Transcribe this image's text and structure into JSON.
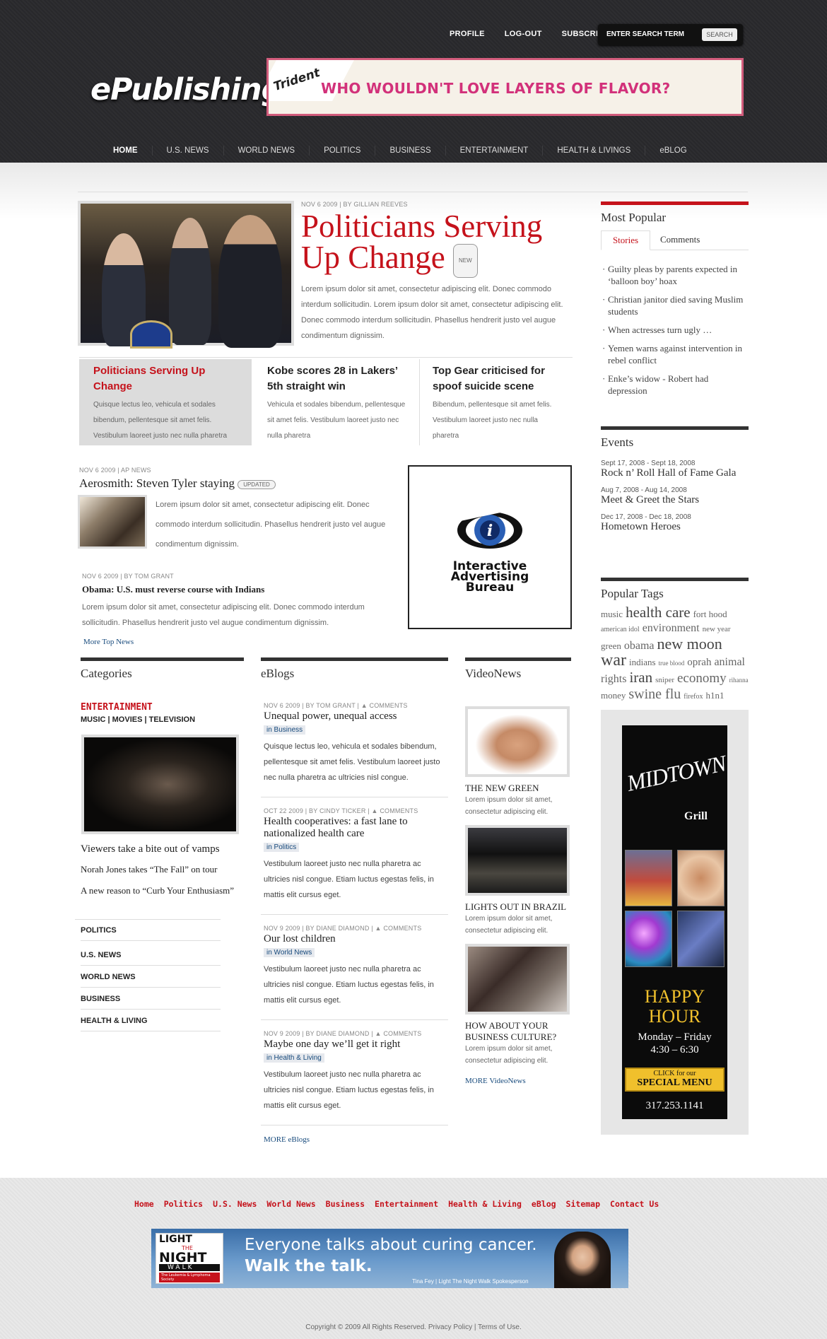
{
  "header": {
    "logo": "ePublishing",
    "top_links": [
      "PROFILE",
      "LOG-OUT",
      "SUBSCRIBE"
    ],
    "search": {
      "placeholder": "ENTER SEARCH TERM",
      "button": "SEARCH"
    },
    "banner": {
      "brand": "Trident",
      "text": "WHO WOULDN'T LOVE LAYERS OF FLAVOR?"
    },
    "nav": [
      "HOME",
      "U.S. NEWS",
      "WORLD NEWS",
      "POLITICS",
      "BUSINESS",
      "ENTERTAINMENT",
      "HEALTH & LIVINGS",
      "eBLOG"
    ]
  },
  "featured": {
    "meta": "NOV 6 2009 | BY GILLIAN REEVES",
    "title": "Politicians Serving Up Change",
    "badge": "NEW",
    "body": "Lorem ipsum dolor sit amet, consectetur adipiscing elit. Donec commodo interdum sollicitudin. Lorem ipsum dolor sit amet, consectetur adipiscing elit. Donec commodo interdum sollicitudin. Phasellus hendrerit justo vel augue condimentum dignissim."
  },
  "subfeatures": [
    {
      "title": "Politicians Serving Up Change",
      "body": "Quisque lectus leo, vehicula et sodales bibendum, pellentesque sit amet felis. Vestibulum laoreet justo nec nulla pharetra"
    },
    {
      "title": "Kobe scores 28 in Lakers’ 5th straight win",
      "body": "Vehicula et sodales bibendum, pellentesque sit amet felis. Vestibulum laoreet justo nec nulla pharetra"
    },
    {
      "title": "Top Gear criticised for spoof suicide scene",
      "body": "Bibendum, pellentesque sit amet felis. Vestibulum laoreet justo nec nulla pharetra"
    }
  ],
  "secondary": {
    "meta1": "NOV 6 2009 | AP NEWS",
    "title1": "Aerosmith: Steven Tyler staying",
    "badge1": "UPDATED",
    "body1": "Lorem ipsum dolor sit amet, consectetur adipiscing elit. Donec commodo interdum sollicitudin. Phasellus hendrerit justo vel augue condimentum dignissim.",
    "meta2": "NOV 6 2009 | BY TOM GRANT",
    "title2": "Obama: U.S. must reverse course with Indians",
    "body2": "Lorem ipsum dolor sit amet, consectetur adipiscing elit. Donec commodo interdum sollicitudin. Phasellus hendrerit justo vel augue condimentum dignissim.",
    "more": "More Top News"
  },
  "iab_ad": {
    "line1": "Interactive",
    "line2": "Advertising",
    "line3": "Bureau"
  },
  "categories": {
    "heading": "Categories",
    "label": "ENTERTAINMENT",
    "sub": "MUSIC | MOVIES | TELEVISION",
    "stories": [
      "Viewers take a bite out of vamps",
      "Norah Jones takes “The Fall” on tour",
      "A new reason to “Curb Your Enthusiasm”"
    ],
    "links": [
      "POLITICS",
      "U.S. NEWS",
      "WORLD NEWS",
      "BUSINESS",
      "HEALTH & LIVING"
    ]
  },
  "eblogs": {
    "heading": "eBlogs",
    "items": [
      {
        "date": "NOV 6 2009",
        "author": "BY TOM GRANT",
        "comments": "COMMENTS",
        "title": "Unequal power, unequal access",
        "cat": "in Business",
        "body": "Quisque lectus leo, vehicula et sodales bibendum, pellentesque sit amet felis. Vestibulum laoreet justo nec nulla pharetra ac ultricies nisl congue."
      },
      {
        "date": "OCT 22 2009",
        "author": "BY CINDY TICKER",
        "comments": "COMMENTS",
        "title": "Health cooperatives: a fast lane to nationalized health care",
        "cat": "in Politics",
        "body": "Vestibulum laoreet justo nec nulla pharetra ac ultricies nisl congue. Etiam luctus egestas felis, in mattis elit cursus eget."
      },
      {
        "date": "NOV 9 2009",
        "author": "BY DIANE DIAMOND",
        "comments": "COMMENTS",
        "title": "Our lost children",
        "cat": "in World News",
        "body": "Vestibulum laoreet justo nec nulla pharetra ac ultricies nisl congue. Etiam luctus egestas felis, in mattis elit cursus eget."
      },
      {
        "date": "NOV 9 2009",
        "author": "BY DIANE DIAMOND",
        "comments": "COMMENTS",
        "title": "Maybe one day we’ll get it right",
        "cat": "in Health & Living",
        "body": "Vestibulum laoreet justo nec nulla pharetra ac ultricies nisl congue. Etiam luctus egestas felis, in mattis elit cursus eget."
      }
    ],
    "more": "MORE eBlogs"
  },
  "videonews": {
    "heading": "VideoNews",
    "items": [
      {
        "title": "THE NEW GREEN",
        "body": "Lorem ipsum dolor sit amet, consectetur adipiscing elit."
      },
      {
        "title": "LIGHTS OUT IN BRAZIL",
        "body": "Lorem ipsum dolor sit amet, consectetur adipiscing elit."
      },
      {
        "title": "HOW ABOUT YOUR BUSINESS CULTURE?",
        "body": "Lorem ipsum dolor sit amet, consectetur adipiscing elit."
      }
    ],
    "more": "MORE VideoNews"
  },
  "sidebar": {
    "popular_heading": "Most Popular",
    "tabs": [
      "Stories",
      "Comments"
    ],
    "popular": [
      "Guilty pleas by parents expected in ‘balloon boy’ hoax",
      "Christian janitor died saving Muslim students",
      "When actresses turn ugly …",
      "Yemen warns against intervention in rebel conflict",
      "Enke’s widow - Robert had depression"
    ],
    "events_heading": "Events",
    "events": [
      {
        "date": "Sept 17, 2008 - Sept 18, 2008",
        "title": "Rock n’ Roll Hall of Fame Gala"
      },
      {
        "date": "Aug 7, 2008 - Aug 14, 2008",
        "title": "Meet & Greet the Stars"
      },
      {
        "date": "Dec 17, 2008 - Dec 18, 2008",
        "title": "Hometown Heroes"
      }
    ],
    "tags_heading": "Popular Tags",
    "tags": [
      "music",
      "health care",
      "fort hood",
      "american idol",
      "environment",
      "new year",
      "green",
      "obama",
      "new moon",
      "war",
      "indians",
      "true blood",
      "oprah",
      "animal rights",
      "iran",
      "sniper",
      "economy",
      "rihanna",
      "money",
      "swine flu",
      "firefox",
      "h1n1"
    ],
    "midtown": {
      "name": "MIDTOWN",
      "grill": "Grill",
      "happy": "HAPPY",
      "hour": "HOUR",
      "days": "Monday – Friday",
      "time": "4:30 – 6:30",
      "click": "CLICK for our",
      "menu": "SPECIAL MENU",
      "phone": "317.253.1141"
    }
  },
  "footer": {
    "links": [
      "Home",
      "Politics",
      "U.S. News",
      "World News",
      "Business",
      "Entertainment",
      "Health & Living",
      "eBlog",
      "Sitemap",
      "Contact Us"
    ],
    "ad": {
      "logo1": "LIGHT",
      "logo2": "THE",
      "logo3": "NIGHT",
      "logo4": "WALK",
      "logo5": "The Leukemia & Lymphoma Society",
      "line1": "Everyone talks about curing cancer.",
      "line2": "Walk the talk.",
      "caption": "Tina Fey | Light The Night Walk Spokesperson"
    },
    "copyright": "Copyright © 2009 All Rights Reserved. Privacy Policy | Terms of Use."
  }
}
